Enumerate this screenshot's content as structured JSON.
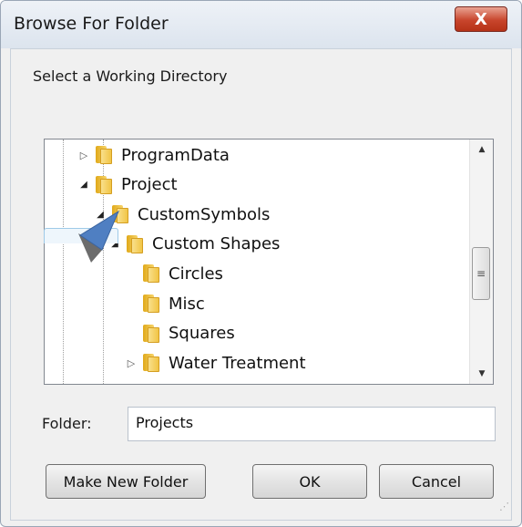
{
  "window": {
    "title": "Browse For Folder",
    "close_glyph": "X"
  },
  "prompt": "Select a Working Directory",
  "tree": {
    "items": [
      {
        "label": "ProgramData",
        "expander": "▷",
        "level": 0
      },
      {
        "label": "Project",
        "expander": "◢",
        "level": 0
      },
      {
        "label": "CustomSymbols",
        "expander": "◢",
        "level": 1
      },
      {
        "label": "Custom Shapes",
        "expander": "◢",
        "level": 2
      },
      {
        "label": "Circles",
        "expander": "",
        "level": 3
      },
      {
        "label": "Misc",
        "expander": "",
        "level": 3
      },
      {
        "label": "Squares",
        "expander": "",
        "level": 3
      },
      {
        "label": "Water Treatment",
        "expander": "▷",
        "level": 3
      }
    ],
    "scrollbar": {
      "up": "▲",
      "down": "▼",
      "thumb": "≡"
    }
  },
  "folder_field": {
    "label": "Folder:",
    "value": "Projects"
  },
  "buttons": {
    "make_new_folder": "Make New Folder",
    "ok": "OK",
    "cancel": "Cancel"
  },
  "colors": {
    "accent": "#c8452c",
    "folder": "#f1c545",
    "cursor": "#4f7fc2"
  },
  "icons": {
    "close": "close-icon",
    "folder": "folder-icon",
    "cursor": "mouse-cursor-icon",
    "grip": "resize-grip-icon"
  }
}
